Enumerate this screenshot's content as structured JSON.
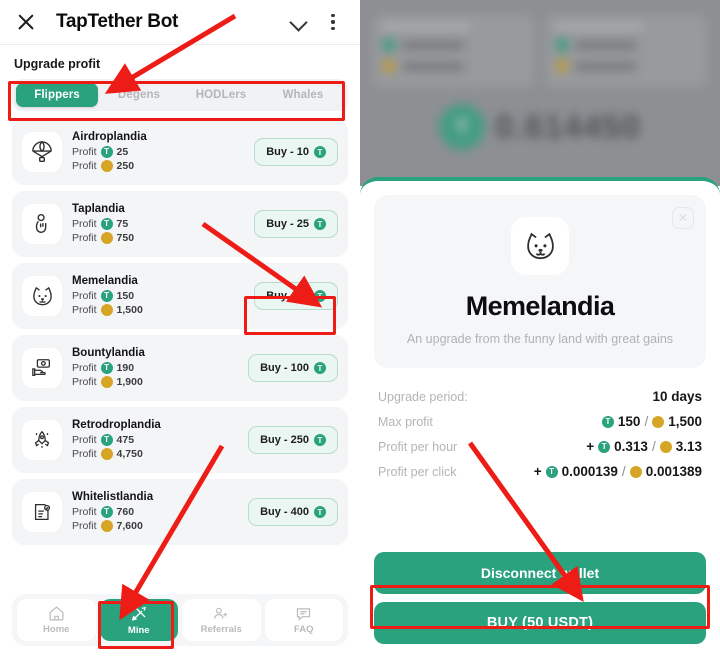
{
  "accent": {
    "green": "#2aa27e",
    "gold": "#d7a526",
    "annotation_red": "#ee1c16"
  },
  "left": {
    "header": {
      "close_icon": "close-icon",
      "title": "TapTether Bot",
      "chevron_icon": "chevron-down-icon",
      "menu_icon": "kebab-menu-icon"
    },
    "section_label": "Upgrade profit",
    "tabs": [
      {
        "label": "Flippers",
        "active": true
      },
      {
        "label": "Degens",
        "active": false
      },
      {
        "label": "HODLers",
        "active": false
      },
      {
        "label": "Whales",
        "active": false
      }
    ],
    "profit_label": "Profit",
    "upgrades": [
      {
        "icon": "parachute-icon",
        "name": "Airdroplandia",
        "profit_token": "25",
        "profit_gold": "250",
        "buy": "Buy - 10"
      },
      {
        "icon": "tap-hand-icon",
        "name": "Taplandia",
        "profit_token": "75",
        "profit_gold": "750",
        "buy": "Buy - 25"
      },
      {
        "icon": "shiba-dog-icon",
        "name": "Memelandia",
        "profit_token": "150",
        "profit_gold": "1,500",
        "buy": "Buy - 50"
      },
      {
        "icon": "money-hand-icon",
        "name": "Bountylandia",
        "profit_token": "190",
        "profit_gold": "1,900",
        "buy": "Buy - 100"
      },
      {
        "icon": "rocket-icon",
        "name": "Retrodroplandia",
        "profit_token": "475",
        "profit_gold": "4,750",
        "buy": "Buy - 250"
      },
      {
        "icon": "document-check-icon",
        "name": "Whitelistlandia",
        "profit_token": "760",
        "profit_gold": "7,600",
        "buy": "Buy - 400"
      }
    ],
    "bottom_nav": [
      {
        "icon": "home-icon",
        "label": "Home",
        "active": false
      },
      {
        "icon": "pickaxe-icon",
        "label": "Mine",
        "active": true
      },
      {
        "icon": "referrals-icon",
        "label": "Referrals",
        "active": false
      },
      {
        "icon": "faq-chat-icon",
        "label": "FAQ",
        "active": false
      }
    ]
  },
  "right": {
    "background_balance": "0.614450",
    "modal": {
      "close_icon": "close-icon",
      "hero_icon": "shiba-dog-icon",
      "title": "Memelandia",
      "description": "An upgrade from the funny land with great gains",
      "stats": [
        {
          "key": "Upgrade period:",
          "prefix": "",
          "token": "",
          "gold": "",
          "plain": "10 days"
        },
        {
          "key": "Max profit",
          "prefix": "",
          "token": "150",
          "gold": "1,500",
          "plain": ""
        },
        {
          "key": "Profit per hour",
          "prefix": "+",
          "token": "0.313",
          "gold": "3.13",
          "plain": ""
        },
        {
          "key": "Profit per click",
          "prefix": "+",
          "token": "0.000139",
          "gold": "0.001389",
          "plain": ""
        }
      ],
      "disconnect_label": "Disconnect wallet",
      "buy_label": "BUY (50 USDT)"
    }
  }
}
